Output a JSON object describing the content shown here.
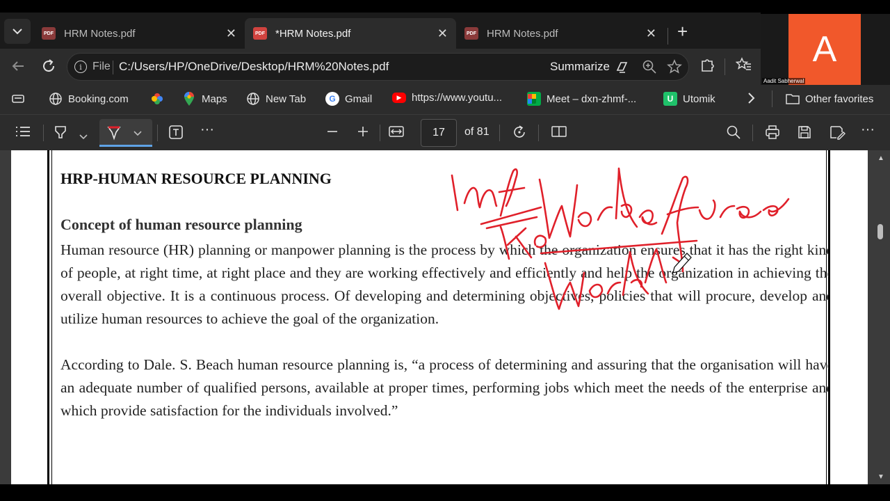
{
  "tabs": [
    {
      "title": "HRM Notes.pdf",
      "close": "✕"
    },
    {
      "title": "*HRM Notes.pdf",
      "close": "✕"
    },
    {
      "title": "HRM Notes.pdf",
      "close": "✕"
    }
  ],
  "pdf_badge": "PDF",
  "address": {
    "scheme_label": "File",
    "url": "C:/Users/HP/OneDrive/Desktop/HRM%20Notes.pdf",
    "summarize_label": "Summarize"
  },
  "bookmarks": [
    {
      "label": "Booking.com",
      "icon": "globe-icon"
    },
    {
      "label": "",
      "icon": "photos-pinwheel-icon"
    },
    {
      "label": "Maps",
      "icon": "maps-pin-icon"
    },
    {
      "label": "New Tab",
      "icon": "globe-icon"
    },
    {
      "label": "Gmail",
      "icon": "google-g-icon"
    },
    {
      "label": "https://www.youtu...",
      "icon": "youtube-icon"
    },
    {
      "label": "Meet – dxn-zhmf-...",
      "icon": "meet-icon"
    },
    {
      "label": "Utomik",
      "icon": "utomik-icon"
    },
    {
      "label": "Other favorites",
      "icon": "folder-icon"
    }
  ],
  "webcam": {
    "initial": "A",
    "name": "Aadit Sabherwal"
  },
  "pdf_toolbar": {
    "page": "17",
    "page_count": "of 81"
  },
  "document": {
    "heading": "HRP-HUMAN RESOURCE PLANNING",
    "subheading": "Concept of human resource planning",
    "para1": "Human resource (HR) planning or manpower planning is the process by which the organization ensures that it has the right kind of people, at right time, at right place and they are working effectively and efficiently and help the organization in achieving the overall objective. It is a continuous process. Of developing and determining objectives, policies that will procure, develop and utilize human resources to achieve the goal of the organization.",
    "para2": "According to Dale. S. Beach human resource planning is, “a process of determining and assuring that the organisation will have an adequate number of qualified persons, available at proper times, performing jobs which meet the needs of the enterprise and which provide satisfaction for the individuals involved.”"
  },
  "ink_color": "#e0202a",
  "accent_color": "#5fa3e6"
}
